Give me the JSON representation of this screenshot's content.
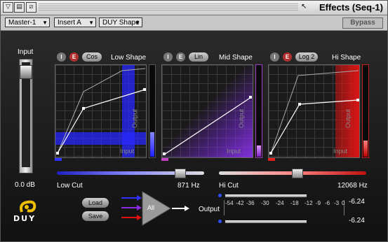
{
  "window": {
    "title": "Effects (Seq-1)"
  },
  "toolbar": {
    "master": "Master-1",
    "insert": "Insert A",
    "shape": "DUY Shape",
    "bypass": "Bypass"
  },
  "input": {
    "label": "Input",
    "value": "0.0 dB"
  },
  "low": {
    "i": "I",
    "e": "E",
    "curve": "Cos",
    "title": "Low Shape",
    "output_label": "Output",
    "input_label": "Input",
    "meter_level": 0.27
  },
  "mid": {
    "i": "I",
    "e": "E",
    "curve": "Lin",
    "title": "Mid Shape",
    "output_label": "Output",
    "input_label": "Input",
    "meter_level": 0.12
  },
  "hi": {
    "i": "I",
    "e": "E",
    "curve": "Log 2",
    "title": "Hi Shape",
    "output_label": "Output",
    "input_label": "Input",
    "meter_level": 0.18
  },
  "low_cut": {
    "label": "Low Cut",
    "value": "871 Hz"
  },
  "hi_cut": {
    "label": "Hi Cut",
    "value": "12068 Hz"
  },
  "logo": {
    "text": "DUY"
  },
  "controls": {
    "load": "Load",
    "save": "Save",
    "routing": "All"
  },
  "output": {
    "label": "Output",
    "scale": [
      "-54",
      "-42",
      "-36",
      "-30",
      "-24",
      "-18",
      "-12",
      "-9",
      "-6",
      "-3",
      "0"
    ],
    "left_value": "-6.24",
    "right_value": "-6.24"
  },
  "colors": {
    "low": "#2a2aff",
    "mid": "#8a2ae0",
    "hi": "#e01010"
  }
}
